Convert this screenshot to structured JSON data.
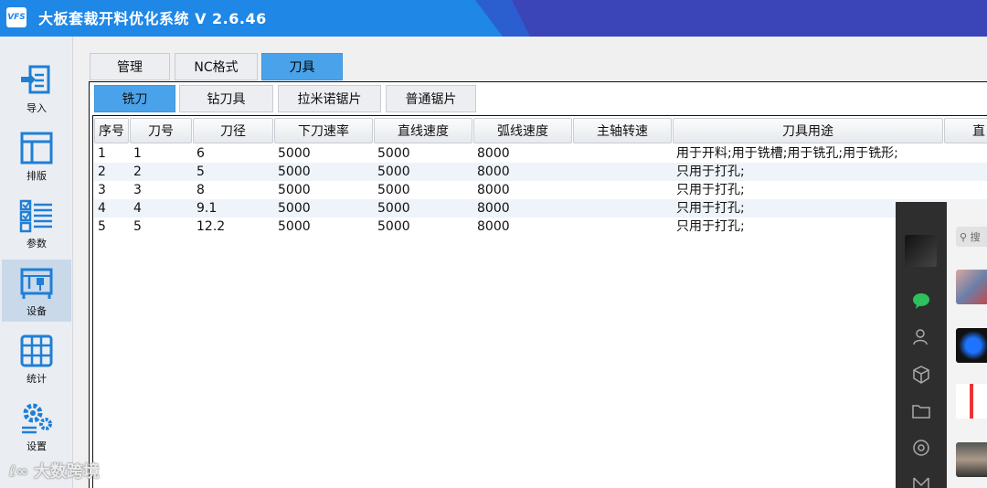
{
  "titlebar": {
    "logo_text": "VFS",
    "title": "大板套裁开料优化系统  V 2.6.46"
  },
  "sidebar": {
    "items": [
      {
        "label": "导入",
        "icon": "import-icon"
      },
      {
        "label": "排版",
        "icon": "layout-icon"
      },
      {
        "label": "参数",
        "icon": "parameters-icon"
      },
      {
        "label": "设备",
        "icon": "device-icon",
        "active": true
      },
      {
        "label": "统计",
        "icon": "statistics-icon"
      },
      {
        "label": "设置",
        "icon": "settings-icon"
      }
    ]
  },
  "top_tabs": [
    {
      "label": "管理"
    },
    {
      "label": "NC格式"
    },
    {
      "label": "刀具",
      "active": true
    }
  ],
  "sub_tabs": [
    {
      "label": "铣刀",
      "active": true
    },
    {
      "label": "钻刀具"
    },
    {
      "label": "拉米诺锯片"
    },
    {
      "label": "普通锯片"
    }
  ],
  "table": {
    "columns": [
      "序号",
      "刀号",
      "刀径",
      "下刀速率",
      "直线速度",
      "弧线速度",
      "主轴转速",
      "刀具用途",
      "直"
    ],
    "rows": [
      [
        "1",
        "1",
        "6",
        "5000",
        "5000",
        "8000",
        "",
        "用于开料;用于铣槽;用于铣孔;用于铣形;"
      ],
      [
        "2",
        "2",
        "5",
        "5000",
        "5000",
        "8000",
        "",
        "只用于打孔;"
      ],
      [
        "3",
        "3",
        "8",
        "5000",
        "5000",
        "8000",
        "",
        "只用于打孔;"
      ],
      [
        "4",
        "4",
        "9.1",
        "5000",
        "5000",
        "8000",
        "",
        "只用于打孔;"
      ],
      [
        "5",
        "5",
        "12.2",
        "5000",
        "5000",
        "8000",
        "",
        "只用于打孔;"
      ]
    ]
  },
  "chat_overlay": {
    "search_placeholder": "搜"
  },
  "watermark": {
    "text": "大数跨境"
  },
  "colors": {
    "titlebar": "#1f87e6",
    "tab_active": "#4aa3ea",
    "sidebar_bg": "#eaeef3"
  }
}
